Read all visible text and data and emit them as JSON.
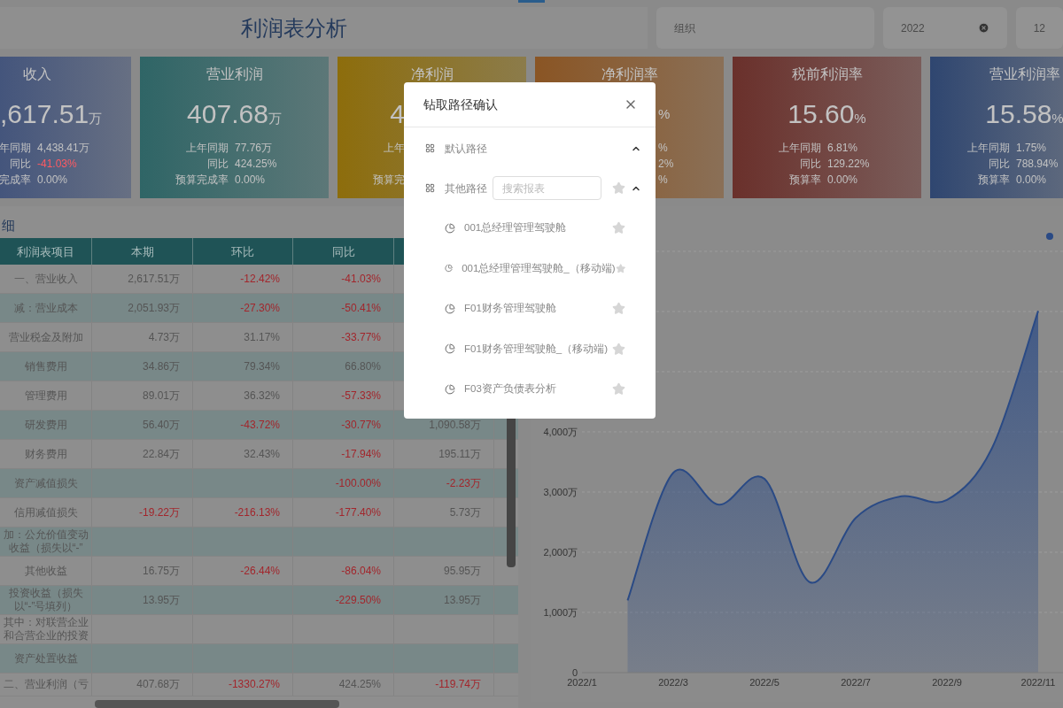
{
  "header": {
    "title": "利润表分析",
    "filters": [
      {
        "kind": "text",
        "value": "组织"
      },
      {
        "kind": "clearable",
        "value": "2022"
      },
      {
        "kind": "text",
        "value": "12"
      }
    ]
  },
  "cards": [
    {
      "kind": "leftcut",
      "color": "#44557c",
      "title": "收入",
      "value": ",617.51",
      "unit": "万",
      "rows": [
        {
          "label": "年同期",
          "value": "4,438.41万",
          "negative": false
        },
        {
          "label": "同比",
          "value": "-41.03%",
          "negative": true
        },
        {
          "label": "完成率",
          "value": "0.00%",
          "negative": false
        }
      ]
    },
    {
      "kind": "full",
      "color": "#2f6566",
      "title": "营业利润",
      "value": "407.68",
      "unit": "万",
      "rows": [
        {
          "label": "上年同期",
          "value": "77.76万",
          "negative": false
        },
        {
          "label": "同比",
          "value": "424.25%",
          "negative": false
        },
        {
          "label": "预算完成率",
          "value": "0.00%",
          "negative": false
        }
      ]
    },
    {
      "kind": "leftpart",
      "color": "#8d6d0c",
      "title": "净利润",
      "value": "4",
      "rows": [
        {
          "label": "上年"
        },
        {
          "label": "预算完"
        }
      ]
    },
    {
      "kind": "rightpart",
      "color": "#8a5524",
      "title": "净利润率",
      "unit": "%",
      "rows": [
        {
          "value": "%",
          "negative": false
        },
        {
          "value": "2%",
          "negative": false
        },
        {
          "value": "%",
          "negative": false
        }
      ]
    },
    {
      "kind": "full",
      "color": "#6a302b",
      "title": "税前利润率",
      "value": "15.60",
      "unit": "%",
      "rows": [
        {
          "label": "上年同期",
          "value": "6.81%",
          "negative": false
        },
        {
          "label": "同比",
          "value": "129.22%",
          "negative": false
        },
        {
          "label": "预算率",
          "value": "0.00%",
          "negative": false
        }
      ]
    },
    {
      "kind": "full",
      "color": "#2f4670",
      "title": "营业利润率",
      "value": "15.58",
      "unit": "%",
      "rows": [
        {
          "label": "上年同期",
          "value": "1.75%",
          "negative": false
        },
        {
          "label": "同比",
          "value": "788.94%",
          "negative": false
        },
        {
          "label": "预算率",
          "value": "0.00%",
          "negative": false
        }
      ]
    }
  ],
  "detail": {
    "title": "细",
    "columns": [
      "利润表项目",
      "本期",
      "环比",
      "同比"
    ],
    "rows": [
      [
        {
          "text": "一、营业收入",
          "negative": false
        },
        {
          "text": "2,617.51万",
          "negative": false
        },
        {
          "text": "-12.42%",
          "negative": true
        },
        {
          "text": "-41.03%",
          "negative": true
        },
        null
      ],
      [
        {
          "text": "减：营业成本",
          "negative": false
        },
        {
          "text": "2,051.93万",
          "negative": false
        },
        {
          "text": "-27.30%",
          "negative": true
        },
        {
          "text": "-50.41%",
          "negative": true
        },
        null
      ],
      [
        {
          "text": "营业税金及附加",
          "negative": false
        },
        {
          "text": "4.73万",
          "negative": false
        },
        {
          "text": "31.17%",
          "negative": false
        },
        {
          "text": "-33.77%",
          "negative": true
        },
        null
      ],
      [
        {
          "text": "销售费用",
          "negative": false
        },
        {
          "text": "34.86万",
          "negative": false
        },
        {
          "text": "79.34%",
          "negative": false
        },
        {
          "text": "66.80%",
          "negative": false
        },
        null
      ],
      [
        {
          "text": "管理费用",
          "negative": false
        },
        {
          "text": "89.01万",
          "negative": false
        },
        {
          "text": "36.32%",
          "negative": false
        },
        {
          "text": "-57.33%",
          "negative": true
        },
        null
      ],
      [
        {
          "text": "研发费用",
          "negative": false
        },
        {
          "text": "56.40万",
          "negative": false
        },
        {
          "text": "-43.72%",
          "negative": true
        },
        {
          "text": "-30.77%",
          "negative": true
        },
        {
          "text": "1,090.58万",
          "negative": false
        }
      ],
      [
        {
          "text": "财务费用",
          "negative": false
        },
        {
          "text": "22.84万",
          "negative": false
        },
        {
          "text": "32.43%",
          "negative": false
        },
        {
          "text": "-17.94%",
          "negative": true
        },
        {
          "text": "195.11万",
          "negative": false
        }
      ],
      [
        {
          "text": "资产减值损失",
          "negative": false
        },
        null,
        null,
        {
          "text": "-100.00%",
          "negative": true
        },
        {
          "text": "-2.23万",
          "negative": true
        }
      ],
      [
        {
          "text": "信用减值损失",
          "negative": false
        },
        {
          "text": "-19.22万",
          "negative": true
        },
        {
          "text": "-216.13%",
          "negative": true
        },
        {
          "text": "-177.40%",
          "negative": true
        },
        {
          "text": "5.73万",
          "negative": false
        }
      ],
      [
        {
          "text": "加：公允价值变动收益（损失以“-”",
          "negative": false
        },
        null,
        null,
        null,
        null
      ],
      [
        {
          "text": "其他收益",
          "negative": false
        },
        {
          "text": "16.75万",
          "negative": false
        },
        {
          "text": "-26.44%",
          "negative": true
        },
        {
          "text": "-86.04%",
          "negative": true
        },
        {
          "text": "95.95万",
          "negative": false
        }
      ],
      [
        {
          "text": "投资收益（损失以“-”号填列）",
          "negative": false
        },
        {
          "text": "13.95万",
          "negative": false
        },
        null,
        {
          "text": "-229.50%",
          "negative": true
        },
        {
          "text": "13.95万",
          "negative": false
        }
      ],
      [
        {
          "text": "其中：对联营企业和合营企业的投资",
          "negative": false
        },
        null,
        null,
        null,
        null
      ],
      [
        {
          "text": "资产处置收益",
          "negative": false
        },
        null,
        null,
        null,
        null
      ],
      [
        {
          "text": "二、营业利润（亏",
          "negative": false
        },
        {
          "text": "407.68万",
          "negative": false
        },
        {
          "text": "-1330.27%",
          "negative": true
        },
        {
          "text": "424.25%",
          "negative": false
        },
        {
          "text": "-119.74万",
          "negative": true
        }
      ]
    ]
  },
  "trend": {
    "chart_data": {
      "type": "area",
      "categories": [
        "2022/1",
        null,
        "2022/3",
        null,
        "2022/5",
        null,
        "2022/7",
        null,
        "2022/9",
        null,
        "2022/11"
      ],
      "series": [
        {
          "color": "#2a4a85",
          "values": [
            null,
            1200,
            3320,
            2790,
            3220,
            1500,
            2570,
            2930,
            2870,
            3750,
            6010
          ]
        }
      ],
      "yticks": [
        {
          "value": 0,
          "label": "0"
        },
        {
          "value": 1000,
          "label": "1,000万"
        },
        {
          "value": 2000,
          "label": "2,000万"
        },
        {
          "value": 3000,
          "label": "3,000万"
        },
        {
          "value": 4000,
          "label": "4,000万"
        }
      ],
      "ylim": [
        0,
        7000
      ],
      "grid": true
    }
  },
  "dialog": {
    "title": "钻取路径确认",
    "sections": [
      {
        "label": "默认路径",
        "expanded": true
      },
      {
        "label": "其他路径",
        "expanded": true,
        "search": {
          "placeholder": "搜索报表"
        },
        "favorite": false,
        "items": [
          {
            "label": "001总经理管理驾驶舱",
            "favorite": false
          },
          {
            "label": "001总经理管理驾驶舱_（移动端)",
            "favorite": false
          },
          {
            "label": "F01财务管理驾驶舱",
            "favorite": false
          },
          {
            "label": "F01财务管理驾驶舱_（移动端)",
            "favorite": false
          },
          {
            "label": "F03资产负债表分析",
            "favorite": false
          }
        ]
      }
    ]
  }
}
